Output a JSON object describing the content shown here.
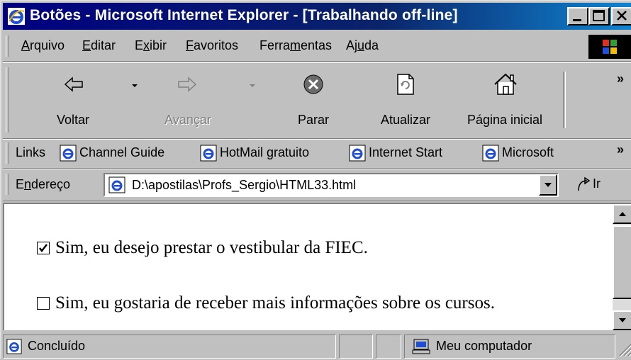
{
  "window": {
    "title": "Botões - Microsoft Internet Explorer - [Trabalhando off-line]"
  },
  "menu": {
    "items": [
      {
        "pre": "",
        "key": "A",
        "post": "rquivo"
      },
      {
        "pre": "",
        "key": "E",
        "post": "ditar"
      },
      {
        "pre": "E",
        "key": "x",
        "post": "ibir"
      },
      {
        "pre": "",
        "key": "F",
        "post": "avoritos"
      },
      {
        "pre": "Ferra",
        "key": "m",
        "post": "entas"
      },
      {
        "pre": "Aj",
        "key": "u",
        "post": "da"
      }
    ]
  },
  "toolbar": {
    "back": "Voltar",
    "forward": "Avançar",
    "stop": "Parar",
    "refresh": "Atualizar",
    "home": "Página inicial",
    "more": "»"
  },
  "links": {
    "label": "Links",
    "items": [
      "Channel Guide",
      "HotMail gratuito",
      "Internet Start",
      "Microsoft"
    ],
    "more": "»"
  },
  "address": {
    "label_pre": "E",
    "label_key": "n",
    "label_post": "dereço",
    "value": "D:\\apostilas\\Profs_Sergio\\HTML33.html",
    "go": "Ir"
  },
  "content": {
    "checkboxes": [
      {
        "label": "Sim, eu desejo prestar o vestibular da FIEC.",
        "checked": true
      },
      {
        "label": "Sim, eu gostaria de receber mais informações sobre os cursos.",
        "checked": false
      }
    ]
  },
  "status": {
    "text": "Concluído",
    "zone": "Meu computador"
  },
  "colors": {
    "title_start": "#000080",
    "title_end": "#1084d0",
    "face": "#c0c0c0"
  },
  "icons": {
    "ie": "ie-logo-icon",
    "back": "back-arrow-icon",
    "forward": "forward-arrow-icon",
    "stop": "stop-icon",
    "refresh": "refresh-icon",
    "home": "home-icon",
    "computer": "computer-icon"
  }
}
